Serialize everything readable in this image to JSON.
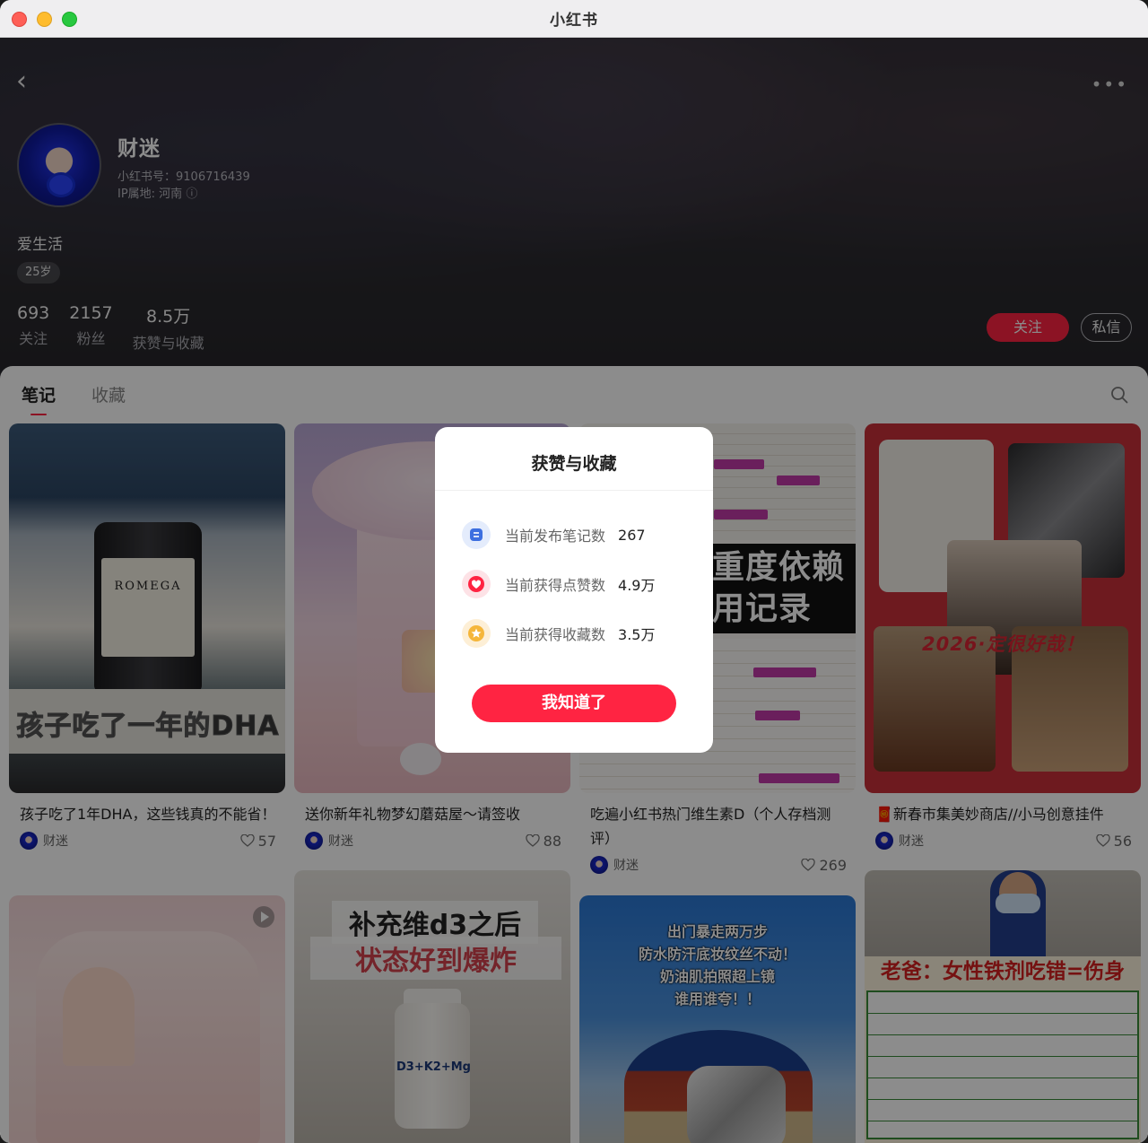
{
  "window": {
    "title": "小红书"
  },
  "profile": {
    "name": "财迷",
    "red_id": "小红书号：9106716439",
    "ip_location": "IP属地: 河南",
    "bio": "爱生活",
    "age_tag": "25岁",
    "stats": [
      {
        "value": "693",
        "label": "关注"
      },
      {
        "value": "2157",
        "label": "粉丝"
      },
      {
        "value": "8.5万",
        "label": "获赞与收藏"
      }
    ],
    "follow_label": "关注",
    "message_label": "私信"
  },
  "tabs": [
    {
      "label": "笔记",
      "active": true
    },
    {
      "label": "收藏",
      "active": false
    }
  ],
  "notes": [
    {
      "title": "孩子吃了1年DHA，这些钱真的不能省！",
      "author": "财迷",
      "likes": "57",
      "cover_brand": "ROMEGA",
      "cover_caption": "孩子吃了一年的DHA"
    },
    {
      "title": "送你新年礼物梦幻蘑菇屋～请签收",
      "author": "财迷",
      "likes": "88"
    },
    {
      "title": "吃遍小红书热门维生素D（个人存档测评）",
      "author": "财迷",
      "likes": "269",
      "cover_caption": "重度依赖用记录"
    },
    {
      "title": "新春市集美妙商店//小马创意挂件",
      "author": "财迷",
      "likes": "56",
      "cover_caption": "2026·定很好哉！"
    },
    {
      "cover_caption": ""
    },
    {
      "cover_caption_1": "补充维d3之后",
      "cover_caption_2": "状态好到爆炸",
      "cover_product": "D3+K2+Mg"
    },
    {
      "cover_caption": [
        "出门暴走两万步",
        "防水防汗底妆纹丝不动！",
        "奶油肌拍照超上镜",
        "谁用谁夸！！"
      ]
    },
    {
      "cover_caption": "老爸：女性铁剂吃错=伤身"
    }
  ],
  "modal": {
    "title": "获赞与收藏",
    "rows": [
      {
        "label": "当前发布笔记数",
        "value": "267",
        "icon": "note-icon"
      },
      {
        "label": "当前获得点赞数",
        "value": "4.9万",
        "icon": "heart-icon"
      },
      {
        "label": "当前获得收藏数",
        "value": "3.5万",
        "icon": "star-icon"
      }
    ],
    "confirm_label": "我知道了"
  },
  "colors": {
    "brand_red": "#ff2442"
  }
}
